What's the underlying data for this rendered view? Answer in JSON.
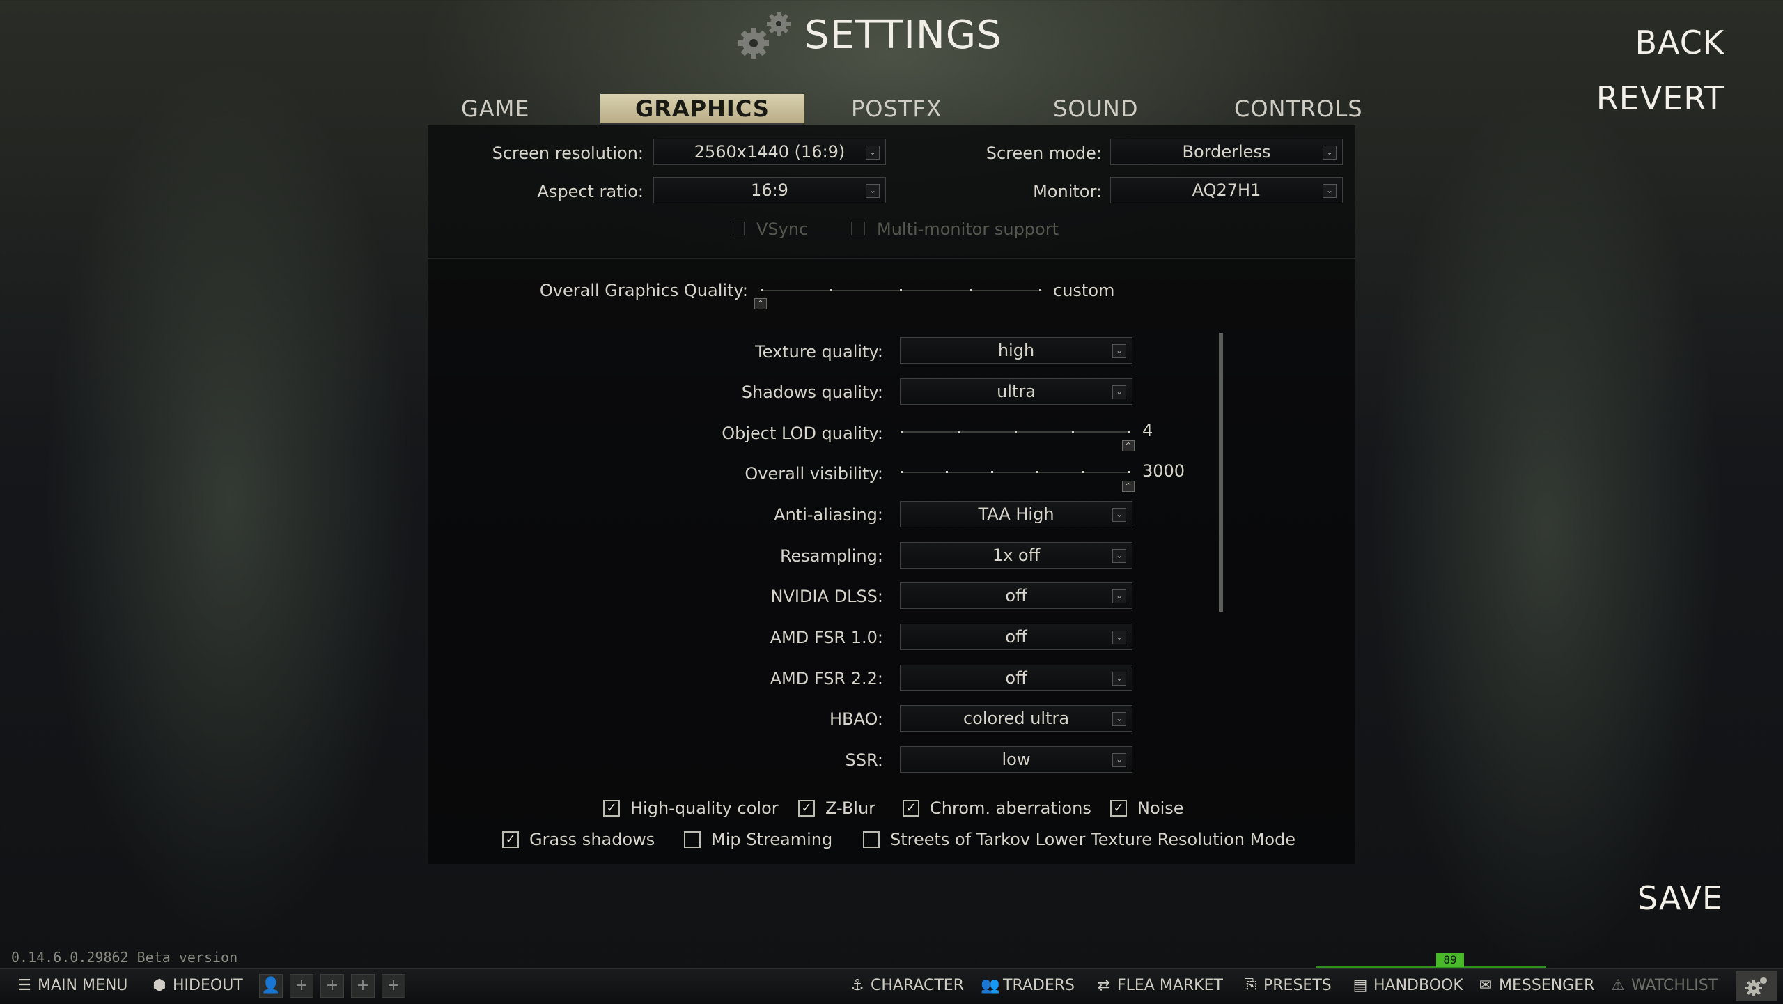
{
  "header": {
    "title": "SETTINGS",
    "back_label": "BACK",
    "revert_label": "REVERT",
    "save_label": "SAVE"
  },
  "tabs": [
    {
      "label": "GAME",
      "active": false
    },
    {
      "label": "GRAPHICS",
      "active": true
    },
    {
      "label": "POSTFX",
      "active": false
    },
    {
      "label": "SOUND",
      "active": false
    },
    {
      "label": "CONTROLS",
      "active": false
    }
  ],
  "display": {
    "screen_resolution": {
      "label": "Screen resolution:",
      "value": "2560x1440 (16:9)"
    },
    "screen_mode": {
      "label": "Screen mode:",
      "value": "Borderless"
    },
    "aspect_ratio": {
      "label": "Aspect ratio:",
      "value": "16:9"
    },
    "monitor": {
      "label": "Monitor:",
      "value": "AQ27H1"
    },
    "vsync": {
      "label": "VSync",
      "checked": false,
      "enabled": false
    },
    "multi_monitor": {
      "label": "Multi-monitor support",
      "checked": false,
      "enabled": false
    }
  },
  "overall_quality": {
    "label": "Overall Graphics Quality:",
    "value": "custom",
    "level": 0
  },
  "quality": {
    "texture": {
      "label": "Texture quality:",
      "value": "high"
    },
    "shadows": {
      "label": "Shadows quality:",
      "value": "ultra"
    },
    "object_lod": {
      "label": "Object LOD quality:",
      "value": "4",
      "level": 1.0
    },
    "visibility": {
      "label": "Overall visibility:",
      "value": "3000",
      "level": 1.0
    },
    "anti_aliasing": {
      "label": "Anti-aliasing:",
      "value": "TAA High"
    },
    "resampling": {
      "label": "Resampling:",
      "value": "1x off"
    },
    "dlss": {
      "label": "NVIDIA DLSS:",
      "value": "off"
    },
    "fsr10": {
      "label": "AMD FSR 1.0:",
      "value": "off"
    },
    "fsr22": {
      "label": "AMD FSR 2.2:",
      "value": "off"
    },
    "hbao": {
      "label": "HBAO:",
      "value": "colored ultra"
    },
    "ssr": {
      "label": "SSR:",
      "value": "low"
    }
  },
  "checkboxes": {
    "hq_color": {
      "label": "High-quality color",
      "checked": true
    },
    "zblur": {
      "label": "Z-Blur",
      "checked": true
    },
    "chrom": {
      "label": "Chrom. aberrations",
      "checked": true
    },
    "noise": {
      "label": "Noise",
      "checked": true
    },
    "grass_shadows": {
      "label": "Grass shadows",
      "checked": true
    },
    "mip_streaming": {
      "label": "Mip Streaming",
      "checked": false
    },
    "streets_lowres": {
      "label": "Streets of Tarkov Lower Texture Resolution Mode",
      "checked": false
    }
  },
  "version": "0.14.6.0.29862 Beta version",
  "fps": "89",
  "bottom_bar": {
    "main_menu": "MAIN MENU",
    "hideout": "HIDEOUT",
    "character": "CHARACTER",
    "traders": "TRADERS",
    "flea_market": "FLEA MARKET",
    "presets": "PRESETS",
    "handbook": "HANDBOOK",
    "messenger": "MESSENGER",
    "watchlist": "WATCHLIST"
  },
  "icons": {
    "menu": "hamburger-icon",
    "hideout": "hideout-icon",
    "character": "character-icon",
    "traders": "traders-icon",
    "flea": "flea-market-icon",
    "presets": "presets-icon",
    "handbook": "handbook-icon",
    "messenger": "messenger-icon",
    "watchlist": "warning-icon",
    "settings": "gear-icon"
  }
}
